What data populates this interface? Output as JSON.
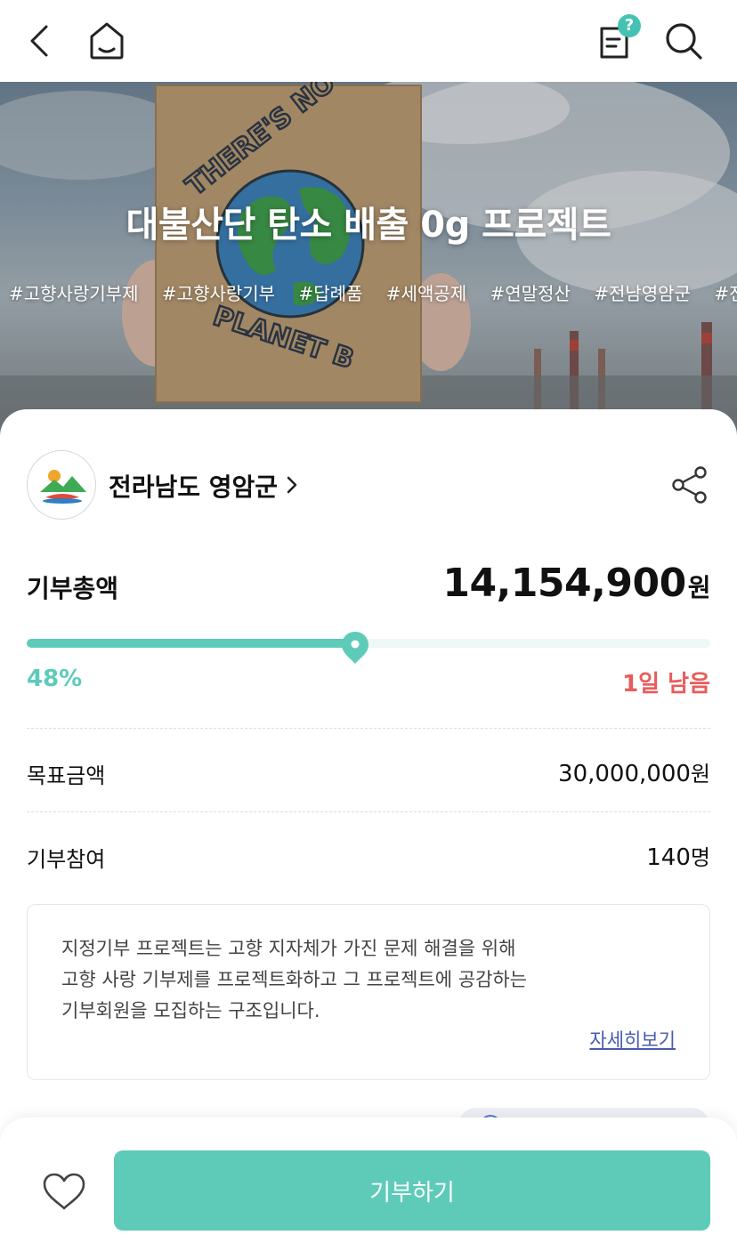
{
  "topbar": {
    "back_icon": "chevron-left-icon",
    "home_icon": "home-icon",
    "guide_icon": "document-question-icon",
    "guide_badge": "?",
    "search_icon": "search-icon"
  },
  "hero": {
    "title": "대불산단 탄소 배출 0g 프로젝트",
    "sign_top_text": "THERE'S NO",
    "sign_bottom_text": "PLANET B",
    "tags": [
      "#고향사랑기부제",
      "#고향사랑기부",
      "#답례품",
      "#세액공제",
      "#연말정산",
      "#전남영암군",
      "#전남"
    ]
  },
  "org": {
    "name": "전라남도 영암군",
    "chevron_icon": "chevron-right-icon",
    "share_icon": "share-icon"
  },
  "donation": {
    "total_label": "기부총액",
    "total_amount": "14,154,900",
    "currency_unit": "원",
    "progress_fraction": 0.48,
    "percent_text": "48%",
    "remaining_text": "1일 남음",
    "goal_label": "목표금액",
    "goal_amount": "30,000,000",
    "participants_label": "기부참여",
    "participants_count": "140",
    "participants_unit": "명"
  },
  "info": {
    "lines": [
      "지정기부 프로젝트는 고향 지자체가 가진 문제 해결을 위해",
      "고향 사랑 기부제를 프로젝트화하고 그 프로젝트에 공감하는",
      "기부회원을 모집하는 구조입니다."
    ],
    "more_link": "자세히보기"
  },
  "bottom": {
    "like_icon": "heart-icon",
    "donate_label": "기부하기"
  },
  "colors": {
    "accent": "#5ecbb9",
    "progress_track": "#eef8f7",
    "remaining_red": "#e85c5c",
    "link_blue": "#4a5bb0",
    "badge_teal": "#45c2b3"
  }
}
